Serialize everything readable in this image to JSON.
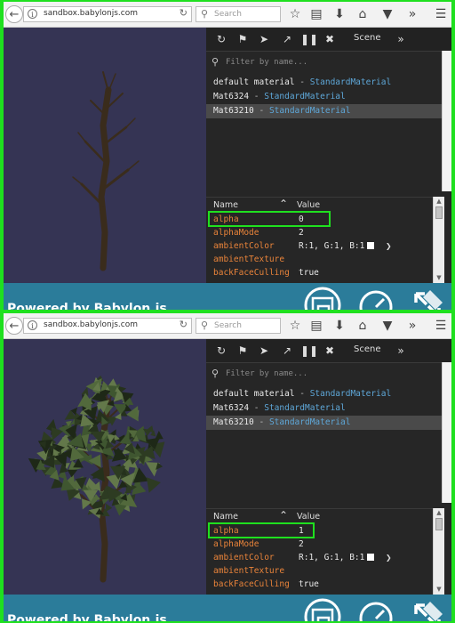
{
  "panels": [
    {
      "id": "before",
      "browser": {
        "url": "sandbox.babylonjs.com",
        "search_placeholder": "Search"
      },
      "inspector": {
        "scene_tab": "Scene",
        "filter_placeholder": "Filter by name...",
        "materials": [
          {
            "name": "default material",
            "sep": " - ",
            "type": "StandardMaterial"
          },
          {
            "name": "Mat6324",
            "sep": " - ",
            "type": "StandardMaterial"
          },
          {
            "name": "Mat63210",
            "sep": " - ",
            "type": "StandardMaterial",
            "selected": true
          }
        ],
        "columns": {
          "name": "Name",
          "value": "Value"
        },
        "properties": [
          {
            "name": "alpha",
            "value": "0",
            "highlighted": true
          },
          {
            "name": "alphaMode",
            "value": "2"
          },
          {
            "name": "ambientColor",
            "value": "R:1, G:1, B:1",
            "swatch": "#ffffff"
          },
          {
            "name": "ambientTexture",
            "value": ""
          },
          {
            "name": "backFaceCulling",
            "value": "true"
          }
        ]
      },
      "footer": {
        "powered": "Powered by Babylon.js"
      },
      "tree_foliage": false
    },
    {
      "id": "after",
      "browser": {
        "url": "sandbox.babylonjs.com",
        "search_placeholder": "Search"
      },
      "inspector": {
        "scene_tab": "Scene",
        "filter_placeholder": "Filter by name...",
        "materials": [
          {
            "name": "default material",
            "sep": " - ",
            "type": "StandardMaterial"
          },
          {
            "name": "Mat6324",
            "sep": " - ",
            "type": "StandardMaterial"
          },
          {
            "name": "Mat63210",
            "sep": " - ",
            "type": "StandardMaterial",
            "selected": true
          }
        ],
        "columns": {
          "name": "Name",
          "value": "Value"
        },
        "properties": [
          {
            "name": "alpha",
            "value": "1",
            "highlighted": true
          },
          {
            "name": "alphaMode",
            "value": "2"
          },
          {
            "name": "ambientColor",
            "value": "R:1, G:1, B:1",
            "swatch": "#ffffff"
          },
          {
            "name": "ambientTexture",
            "value": ""
          },
          {
            "name": "backFaceCulling",
            "value": "true"
          }
        ]
      },
      "footer": {
        "powered": "Powered by Babylon.js"
      },
      "tree_foliage": true
    }
  ],
  "colors": {
    "highlight": "#1fe01f",
    "viewport_bg": "#353454",
    "material_type": "#5ea7d8",
    "property_name": "#e8833a",
    "babylon_bar": "#2b7c9a"
  },
  "icons": [
    "back-arrow-icon",
    "info-icon",
    "reload-icon",
    "search-icon",
    "bookmark-star-icon",
    "reading-list-icon",
    "download-icon",
    "home-icon",
    "pocket-icon",
    "overflow-icon",
    "hamburger-menu-icon",
    "refresh-icon",
    "tag-icon",
    "pointer-icon",
    "popout-icon",
    "pause-icon",
    "close-icon",
    "tab-overflow-icon",
    "filter-search-icon",
    "sort-caret-icon",
    "chevron-right-icon",
    "monitor-icon",
    "stopwatch-icon",
    "fullscreen-icon"
  ]
}
